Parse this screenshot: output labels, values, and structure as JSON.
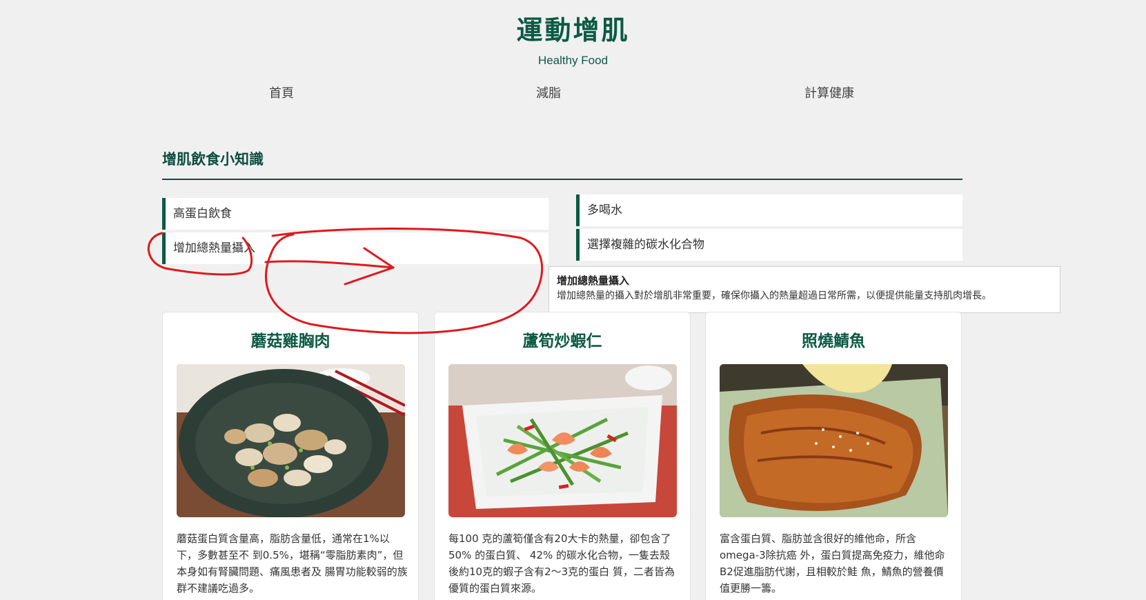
{
  "header": {
    "title": "運動增肌",
    "subtitle": "Healthy Food"
  },
  "nav": {
    "items": [
      {
        "label": "首頁"
      },
      {
        "label": "減脂"
      },
      {
        "label": "計算健康"
      }
    ]
  },
  "tips_section": {
    "title": "增肌飲食小知識",
    "items": [
      {
        "label": "高蛋白飲食"
      },
      {
        "label": "增加總熱量攝入"
      },
      {
        "label": "多喝水"
      },
      {
        "label": "選擇複雜的碳水化合物"
      }
    ],
    "tooltip": {
      "title": "增加總熱量攝入",
      "body": "增加總熱量的攝入對於增肌非常重要，確保你攝入的熱量超過日常所需，以便提供能量支持肌肉增長。"
    }
  },
  "recipes": [
    {
      "title": "蘑菇雞胸肉",
      "image_icon": "mushroom-chicken-photo",
      "description": "蘑菇蛋白質含量高，脂肪含量低，通常在1%以下，多數甚至不 到0.5%，堪稱“零脂肪素肉”，但本身如有腎臟問題、痛風患者及 腸胃功能較弱的族群不建議吃過多。"
    },
    {
      "title": "蘆筍炒蝦仁",
      "image_icon": "asparagus-shrimp-photo",
      "description": "每100 克的蘆筍僅含有20大卡的熱量，卻包含了50% 的蛋白質、 42% 的碳水化合物，一隻去殼後約10克的蝦子含有2～3克的蛋白 質，二者皆為優質的蛋白質來源。"
    },
    {
      "title": "照燒鯖魚",
      "image_icon": "teriyaki-mackerel-photo",
      "description": "富含蛋白質、脂肪並含很好的維他命，所含omega-3除抗癌 外，蛋白質提高免疫力，維他命B2促進脂肪代謝，且相較於鮭 魚，鯖魚的營養價值更勝一籌。"
    }
  ],
  "colors": {
    "brand_green": "#0b5a43",
    "page_background": "#f0f0f0",
    "annotation_red": "#e0181b"
  }
}
